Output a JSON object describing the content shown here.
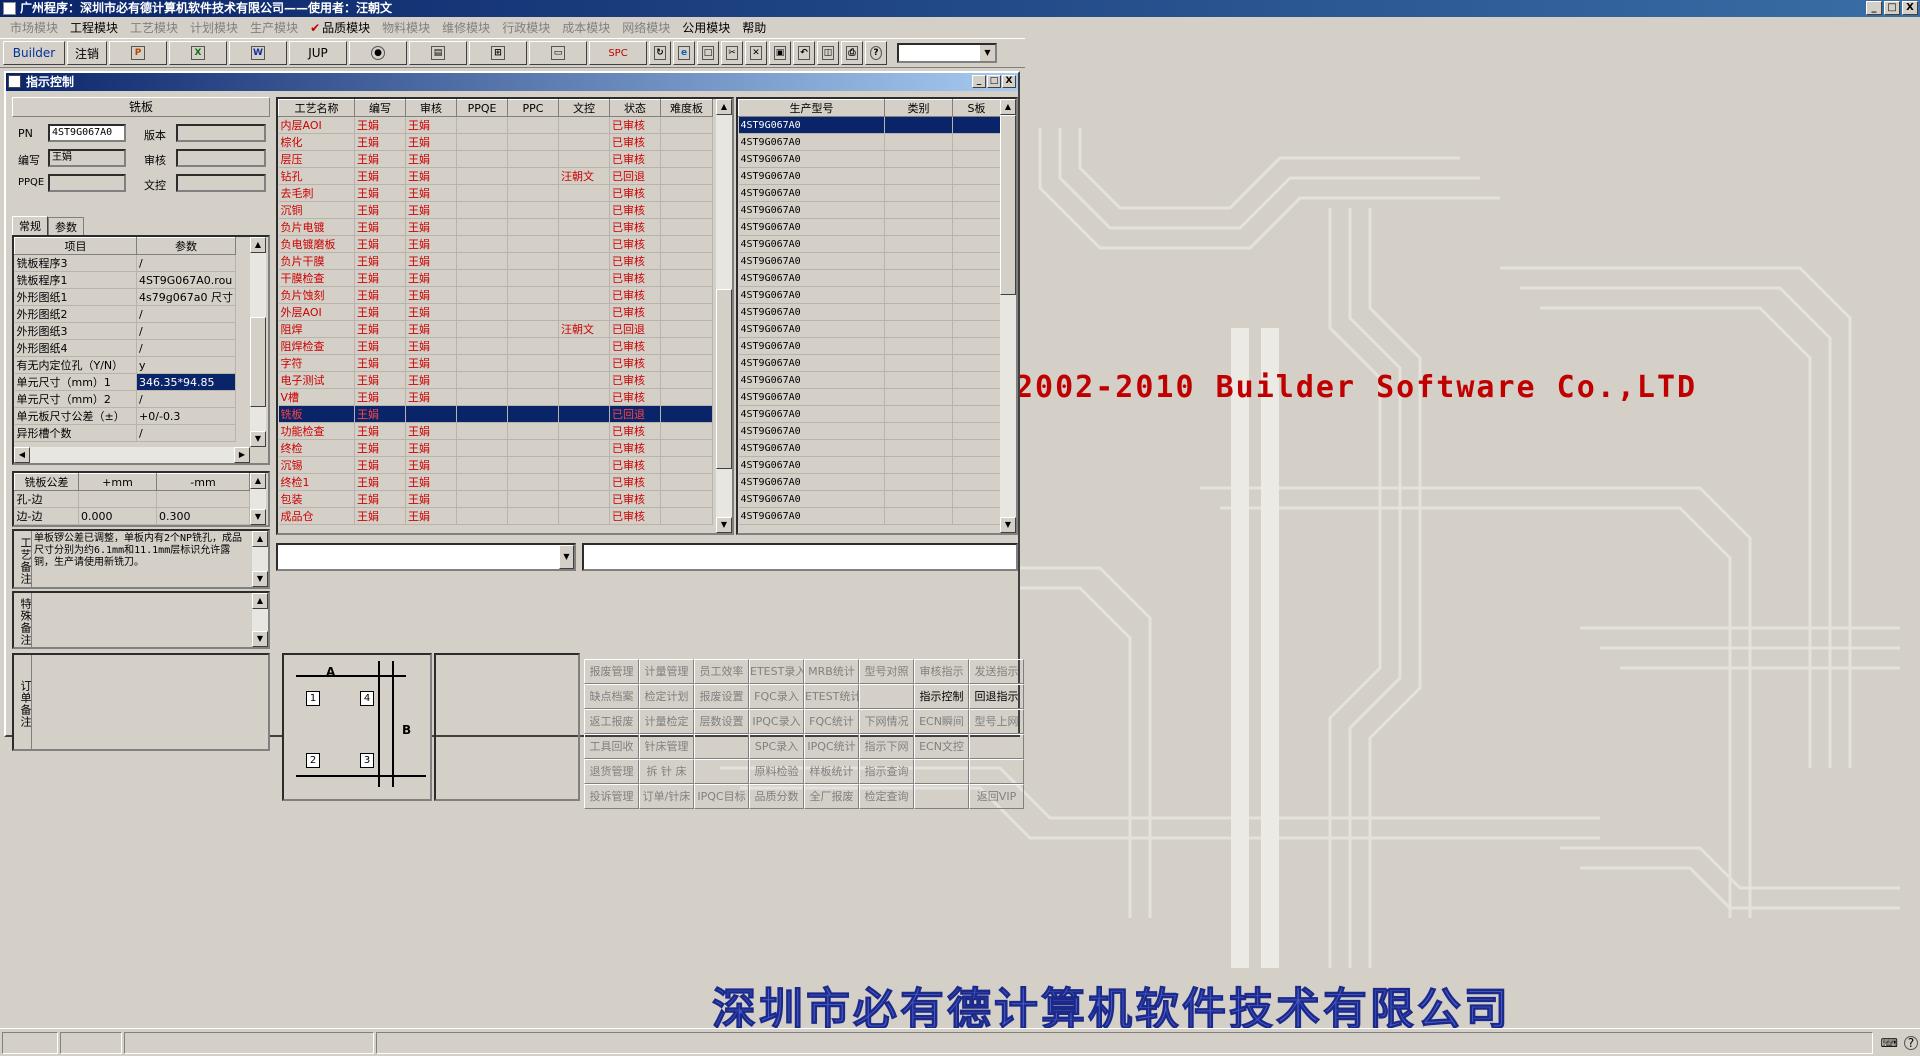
{
  "window": {
    "title": "广州程序：深圳市必有德计算机软件技术有限公司——使用者：汪朝文",
    "min": "_",
    "max": "□",
    "close": "X"
  },
  "menu": {
    "market": "市场模块",
    "engineering": "工程模块",
    "process": "工艺模块",
    "plan": "计划模块",
    "production": "生产模块",
    "quality_check": "✔",
    "quality": "品质模块",
    "material": "物料模块",
    "maintenance": "维修模块",
    "admin": "行政模块",
    "cost": "成本模块",
    "network": "网络模块",
    "public": "公用模块",
    "help": "帮助"
  },
  "toolbar": {
    "builder": "Builder",
    "logout": "注销",
    "jup": "JUP",
    "spc": "SPC",
    "icons": [
      "ppt-icon",
      "excel-icon",
      "word-icon",
      "jup",
      "eye-icon",
      "book-icon",
      "network-icon",
      "print-icon",
      "spc",
      "refresh-icon",
      "ie-icon",
      "doc-icon",
      "cut-icon",
      "delete-icon",
      "save-icon",
      "undo-icon",
      "preview-icon",
      "printer-icon",
      "help-icon"
    ]
  },
  "background": {
    "copyright": "2002-2010 Builder Software Co.,LTD",
    "company": "深圳市必有德计算机软件技术有限公司"
  },
  "dialog": {
    "title": "指示控制",
    "panel_title": "铣板",
    "fields": {
      "pn_label": "PN",
      "pn_value": "4ST9G067A0",
      "version_label": "版本",
      "version_value": "",
      "editor_label": "编写",
      "editor_value": "王娟",
      "review_label": "审核",
      "review_value": "",
      "ppqe_label": "PPQE",
      "ppqe_value": "",
      "doc_label": "文控",
      "doc_value": ""
    },
    "tabs": [
      "常规",
      "参数"
    ],
    "param_headers": [
      "项目",
      "参数"
    ],
    "params": [
      [
        "铣板程序3",
        "/"
      ],
      [
        "铣板程序1",
        "4ST9G067A0.rou"
      ],
      [
        "外形图纸1",
        "4s79g067a0 尺寸"
      ],
      [
        "外形图纸2",
        "/"
      ],
      [
        "外形图纸3",
        "/"
      ],
      [
        "外形图纸4",
        "/"
      ],
      [
        "有无内定位孔（Y/N）",
        "y"
      ],
      [
        "单元尺寸（mm）1",
        "346.35*94.85"
      ],
      [
        "单元尺寸（mm）2",
        "/"
      ],
      [
        "单元板尺寸公差（±）",
        "+0/-0.3"
      ],
      [
        "异形槽个数",
        "/"
      ]
    ],
    "tol_headers": [
      "铣板公差",
      "+mm",
      "-mm"
    ],
    "tolerances": [
      [
        "孔-边",
        "",
        ""
      ],
      [
        "边-边",
        "0.000",
        "0.300"
      ]
    ],
    "notes": {
      "process_label": "工艺备注",
      "process_text": "单板锣公差已调整，单板内有2个NP铣孔，成品尺寸分别为约6.1mm和11.1mm层标识允许露铜，生产请使用新铣刀。",
      "special_label": "特殊备注",
      "order_label": "订单备注"
    },
    "process_headers": [
      "工艺名称",
      "编写",
      "审核",
      "PPQE",
      "PPC",
      "文控",
      "状态",
      "难度板"
    ],
    "process_rows": [
      [
        "内层AOI",
        "王娟",
        "王娟",
        "",
        "",
        "",
        "已审核",
        ""
      ],
      [
        "棕化",
        "王娟",
        "王娟",
        "",
        "",
        "",
        "已审核",
        ""
      ],
      [
        "层压",
        "王娟",
        "王娟",
        "",
        "",
        "",
        "已审核",
        ""
      ],
      [
        "钻孔",
        "王娟",
        "王娟",
        "",
        "",
        "汪朝文",
        "已回退",
        ""
      ],
      [
        "去毛刺",
        "王娟",
        "王娟",
        "",
        "",
        "",
        "已审核",
        ""
      ],
      [
        "沉铜",
        "王娟",
        "王娟",
        "",
        "",
        "",
        "已审核",
        ""
      ],
      [
        "负片电镀",
        "王娟",
        "王娟",
        "",
        "",
        "",
        "已审核",
        ""
      ],
      [
        "负电镀磨板",
        "王娟",
        "王娟",
        "",
        "",
        "",
        "已审核",
        ""
      ],
      [
        "负片干膜",
        "王娟",
        "王娟",
        "",
        "",
        "",
        "已审核",
        ""
      ],
      [
        "干膜检查",
        "王娟",
        "王娟",
        "",
        "",
        "",
        "已审核",
        ""
      ],
      [
        "负片蚀刻",
        "王娟",
        "王娟",
        "",
        "",
        "",
        "已审核",
        ""
      ],
      [
        "外层AOI",
        "王娟",
        "王娟",
        "",
        "",
        "",
        "已审核",
        ""
      ],
      [
        "阻焊",
        "王娟",
        "王娟",
        "",
        "",
        "汪朝文",
        "已回退",
        ""
      ],
      [
        "阻焊检查",
        "王娟",
        "王娟",
        "",
        "",
        "",
        "已审核",
        ""
      ],
      [
        "字符",
        "王娟",
        "王娟",
        "",
        "",
        "",
        "已审核",
        ""
      ],
      [
        "电子测试",
        "王娟",
        "王娟",
        "",
        "",
        "",
        "已审核",
        ""
      ],
      [
        "V槽",
        "王娟",
        "王娟",
        "",
        "",
        "",
        "已审核",
        ""
      ],
      [
        "铣板",
        "王娟",
        "",
        "",
        "",
        "",
        "已回退",
        ""
      ],
      [
        "功能检查",
        "王娟",
        "王娟",
        "",
        "",
        "",
        "已审核",
        ""
      ],
      [
        "终检",
        "王娟",
        "王娟",
        "",
        "",
        "",
        "已审核",
        ""
      ],
      [
        "沉锡",
        "王娟",
        "王娟",
        "",
        "",
        "",
        "已审核",
        ""
      ],
      [
        "终检1",
        "王娟",
        "王娟",
        "",
        "",
        "",
        "已审核",
        ""
      ],
      [
        "包装",
        "王娟",
        "王娟",
        "",
        "",
        "",
        "已审核",
        ""
      ],
      [
        "成品仓",
        "王娟",
        "王娟",
        "",
        "",
        "",
        "已审核",
        ""
      ]
    ],
    "selected_process": 17,
    "model_headers": [
      "生产型号",
      "类别",
      "S板"
    ],
    "models": [
      "4ST9G067A0",
      "4ST9G067A0",
      "4ST9G067A0",
      "4ST9G067A0",
      "4ST9G067A0",
      "4ST9G067A0",
      "4ST9G067A0",
      "4ST9G067A0",
      "4ST9G067A0",
      "4ST9G067A0",
      "4ST9G067A0",
      "4ST9G067A0",
      "4ST9G067A0",
      "4ST9G067A0",
      "4ST9G067A0",
      "4ST9G067A0",
      "4ST9G067A0",
      "4ST9G067A0",
      "4ST9G067A0",
      "4ST9G067A0",
      "4ST9G067A0",
      "4ST9G067A0",
      "4ST9G067A0",
      "4ST9G067A0"
    ],
    "diagram": {
      "a": "A",
      "b": "B",
      "n1": "1",
      "n2": "2",
      "n3": "3",
      "n4": "4"
    },
    "buttons": [
      [
        "报废管理",
        false
      ],
      [
        "计量管理",
        false
      ],
      [
        "员工效率",
        false
      ],
      [
        "ETEST录入",
        false
      ],
      [
        "MRB统计",
        false
      ],
      [
        "型号对照",
        false
      ],
      [
        "审核指示",
        false
      ],
      [
        "发送指示",
        false
      ],
      [
        "缺点档案",
        false
      ],
      [
        "检定计划",
        false
      ],
      [
        "报废设置",
        false
      ],
      [
        "FQC录入",
        false
      ],
      [
        "ETEST统计",
        false
      ],
      [
        "",
        false
      ],
      [
        "指示控制",
        true
      ],
      [
        "回退指示",
        true
      ],
      [
        "返工报废",
        false
      ],
      [
        "计量检定",
        false
      ],
      [
        "层数设置",
        false
      ],
      [
        "IPQC录入",
        false
      ],
      [
        "FQC统计",
        false
      ],
      [
        "下网情况",
        false
      ],
      [
        "ECN瞬间",
        false
      ],
      [
        "型号上网",
        false
      ],
      [
        "工具回收",
        false
      ],
      [
        "针床管理",
        false
      ],
      [
        "",
        false
      ],
      [
        "SPC录入",
        false
      ],
      [
        "IPQC统计",
        false
      ],
      [
        "指示下网",
        false
      ],
      [
        "ECN文控",
        false
      ],
      [
        "",
        false
      ],
      [
        "退货管理",
        false
      ],
      [
        "拆 针 床",
        false
      ],
      [
        "",
        false
      ],
      [
        "原料检验",
        false
      ],
      [
        "样板统计",
        false
      ],
      [
        "指示查询",
        false
      ],
      [
        "",
        false
      ],
      [
        "",
        false
      ],
      [
        "投诉管理",
        false
      ],
      [
        "订单/针床",
        false
      ],
      [
        "IPQC目标",
        false
      ],
      [
        "品质分数",
        false
      ],
      [
        "全厂报废",
        false
      ],
      [
        "检定查询",
        false
      ],
      [
        "",
        false
      ],
      [
        "返回VIP",
        false
      ]
    ]
  }
}
